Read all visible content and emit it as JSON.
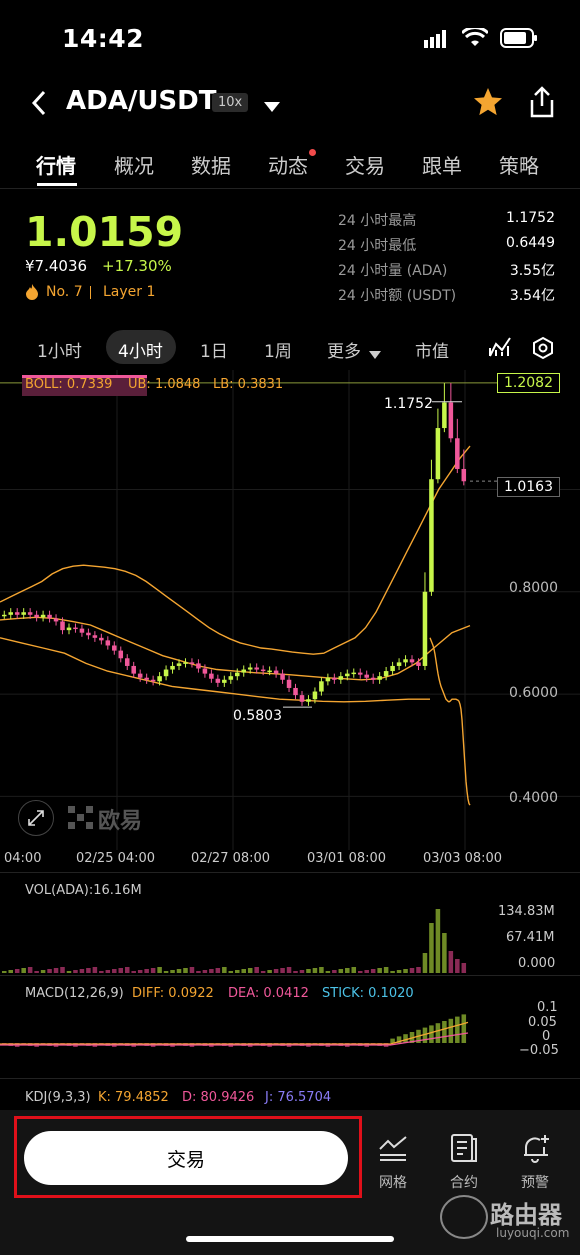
{
  "status_bar": {
    "time": "14:42"
  },
  "header": {
    "pair": "ADA/USDT",
    "leverage": "10x"
  },
  "tabs": [
    "行情",
    "概况",
    "数据",
    "动态",
    "交易",
    "跟单",
    "策略"
  ],
  "ticker": {
    "last_price": "1.0159",
    "cny_price": "¥7.4036",
    "change_pct": "+17.30%",
    "rank": "No. 7",
    "sector": "Layer 1",
    "stats": [
      {
        "label": "24 小时最高",
        "value": "1.1752"
      },
      {
        "label": "24 小时最低",
        "value": "0.6449"
      },
      {
        "label": "24 小时量 (ADA)",
        "value": "3.55亿"
      },
      {
        "label": "24 小时额 (USDT)",
        "value": "3.54亿"
      }
    ]
  },
  "intervals": {
    "items": [
      "1小时",
      "4小时",
      "1日",
      "1周",
      "更多",
      "市值"
    ],
    "selected": "4小时"
  },
  "chart_data": {
    "type": "line",
    "title": "",
    "indicator_boll": {
      "boll": "BOLL: 0.7339",
      "ub": "UB: 1.0848",
      "lb": "LB: 0.3831"
    },
    "y_ticks": [
      "0.8000",
      "0.6000",
      "0.4000"
    ],
    "ylim": [
      0.35,
      1.21
    ],
    "top_value_label": "1.2082",
    "current_price_label": "1.0163",
    "high_label": "1.1752",
    "low_label": "0.5803",
    "x_ticks": [
      "04:00",
      "02/25 04:00",
      "02/27 08:00",
      "03/01 08:00",
      "03/03 08:00"
    ],
    "watermark": "欧易",
    "series": [
      {
        "name": "close",
        "values": [
          0.755,
          0.76,
          0.755,
          0.76,
          0.755,
          0.75,
          0.755,
          0.748,
          0.742,
          0.725,
          0.73,
          0.728,
          0.72,
          0.715,
          0.71,
          0.705,
          0.695,
          0.685,
          0.67,
          0.655,
          0.64,
          0.632,
          0.628,
          0.625,
          0.635,
          0.648,
          0.655,
          0.66,
          0.662,
          0.66,
          0.65,
          0.64,
          0.63,
          0.622,
          0.628,
          0.635,
          0.642,
          0.648,
          0.652,
          0.648,
          0.645,
          0.646,
          0.64,
          0.628,
          0.612,
          0.598,
          0.585,
          0.59,
          0.605,
          0.625,
          0.632,
          0.628,
          0.635,
          0.64,
          0.642,
          0.638,
          0.632,
          0.628,
          0.635,
          0.645,
          0.655,
          0.662,
          0.668,
          0.662,
          0.655,
          0.8,
          1.02,
          1.12,
          1.17,
          1.1,
          1.04,
          1.016
        ]
      },
      {
        "name": "UB",
        "values": [
          0.78,
          0.79,
          0.8,
          0.81,
          0.82,
          0.835,
          0.845,
          0.85,
          0.852,
          0.85,
          0.848,
          0.845,
          0.84,
          0.832,
          0.82,
          0.805,
          0.79,
          0.775,
          0.76,
          0.745,
          0.73,
          0.718,
          0.708,
          0.7,
          0.695,
          0.69,
          0.688,
          0.685,
          0.682,
          0.68,
          0.678,
          0.68,
          0.69,
          0.7,
          0.71,
          0.73,
          0.76,
          0.8,
          0.84,
          0.88,
          0.92,
          0.96,
          1.0,
          1.03,
          1.06,
          1.0848
        ]
      },
      {
        "name": "LB",
        "values": [
          0.71,
          0.705,
          0.7,
          0.695,
          0.688,
          0.678,
          0.665,
          0.652,
          0.64,
          0.63,
          0.622,
          0.615,
          0.61,
          0.605,
          0.6,
          0.595,
          0.59,
          0.588,
          0.586,
          0.585,
          0.586,
          0.588,
          0.59,
          0.59,
          0.59,
          0.59,
          0.59,
          0.589,
          0.588,
          0.586,
          0.58,
          0.57,
          0.55,
          0.52,
          0.49,
          0.46,
          0.43,
          0.41,
          0.395,
          0.386,
          0.3831
        ]
      }
    ]
  },
  "vol": {
    "label": "VOL(ADA):16.16M",
    "ticks": [
      "134.83M",
      "67.41M",
      "0.000"
    ]
  },
  "macd": {
    "label": "MACD(12,26,9)",
    "diff": "DIFF: 0.0922",
    "dea": "DEA: 0.0412",
    "stick": "STICK: 0.1020",
    "ticks": [
      "0.1",
      "0.05",
      "0",
      "−0.05"
    ]
  },
  "kdj": {
    "label": "KDJ(9,3,3)",
    "k": "K: 79.4852",
    "d": "D: 80.9426",
    "j": "J: 76.5704"
  },
  "bottom": {
    "trade_label": "交易",
    "actions": [
      {
        "label": "网格",
        "icon": "grid-chart-icon"
      },
      {
        "label": "合约",
        "icon": "contract-doc-icon"
      },
      {
        "label": "预警",
        "icon": "bell-plus-icon"
      }
    ],
    "watermark_brand": "路由器",
    "watermark_url": "luyouqi.com"
  },
  "colors": {
    "up": "#c7f64a",
    "down": "#f0589a",
    "accent": "#f4a531"
  }
}
